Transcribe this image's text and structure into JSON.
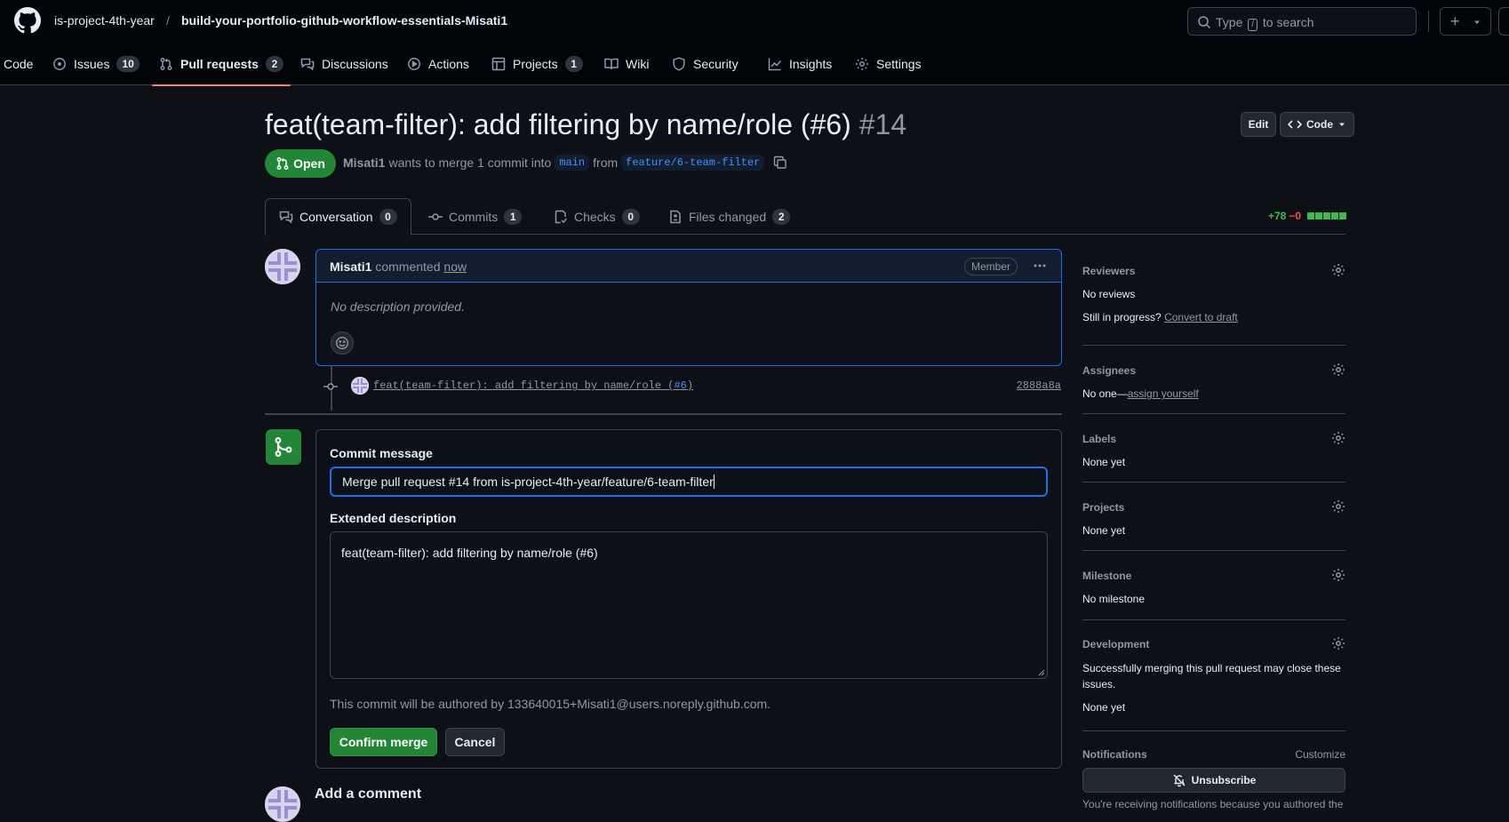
{
  "header": {
    "owner": "is-project-4th-year",
    "separator": "/",
    "repo": "build-your-portfolio-github-workflow-essentials-Misati1",
    "search": {
      "prefix": "Type",
      "key": "/",
      "suffix": "to search"
    }
  },
  "repo_nav": [
    {
      "label": "Code",
      "icon": "code-icon"
    },
    {
      "label": "Issues",
      "count": "10",
      "icon": "issue-icon"
    },
    {
      "label": "Pull requests",
      "count": "2",
      "icon": "pull-request-icon",
      "active": true
    },
    {
      "label": "Discussions",
      "icon": "discussion-icon"
    },
    {
      "label": "Actions",
      "icon": "play-icon"
    },
    {
      "label": "Projects",
      "count": "1",
      "icon": "table-icon"
    },
    {
      "label": "Wiki",
      "icon": "book-icon"
    },
    {
      "label": "Security",
      "icon": "shield-icon"
    },
    {
      "label": "Insights",
      "icon": "graph-icon"
    },
    {
      "label": "Settings",
      "icon": "gear-icon"
    }
  ],
  "pr": {
    "title": "feat(team-filter): add filtering by name/role (#6)",
    "number": "#14",
    "edit_label": "Edit",
    "code_label": "Code",
    "state": "Open",
    "author": "Misati1",
    "merge_text": "wants to merge 1 commit into",
    "base_branch": "main",
    "from_text": "from",
    "head_branch": "feature/6-team-filter"
  },
  "tabs": [
    {
      "label": "Conversation",
      "count": "0",
      "icon": "comment-discussion-icon",
      "active": true
    },
    {
      "label": "Commits",
      "count": "1",
      "icon": "commit-icon"
    },
    {
      "label": "Checks",
      "count": "0",
      "icon": "checklist-icon"
    },
    {
      "label": "Files changed",
      "count": "2",
      "icon": "file-diff-icon"
    }
  ],
  "diffstat": {
    "additions": "+78",
    "deletions": "−0"
  },
  "comment": {
    "author": "Misati1",
    "action": "commented",
    "time": "now",
    "role": "Member",
    "body": "No description provided."
  },
  "commit": {
    "message": "feat(team-filter): add filtering by name/role (",
    "link": "#6",
    "close": ")",
    "sha": "2888a8a"
  },
  "merge_form": {
    "commit_label": "Commit message",
    "commit_value": "Merge pull request #14 from is-project-4th-year/feature/6-team-filter",
    "ext_label": "Extended description",
    "ext_value": "feat(team-filter): add filtering by name/role (#6)",
    "authored_note": "This commit will be authored by 133640015+Misati1@users.noreply.github.com.",
    "confirm_label": "Confirm merge",
    "cancel_label": "Cancel"
  },
  "add_comment": "Add a comment",
  "sidebar": {
    "reviewers": {
      "heading": "Reviewers",
      "value": "No reviews",
      "progress_prefix": "Still in progress?",
      "progress_link": "Convert to draft"
    },
    "assignees": {
      "heading": "Assignees",
      "prefix": "No one—",
      "link": "assign yourself"
    },
    "labels": {
      "heading": "Labels",
      "value": "None yet"
    },
    "projects": {
      "heading": "Projects",
      "value": "None yet"
    },
    "milestone": {
      "heading": "Milestone",
      "value": "No milestone"
    },
    "development": {
      "heading": "Development",
      "note": "Successfully merging this pull request may close these issues.",
      "value": "None yet"
    },
    "notifications": {
      "heading": "Notifications",
      "customize": "Customize",
      "unsubscribe": "Unsubscribe",
      "note": "You're receiving notifications because you authored the"
    }
  },
  "colors": {
    "accent_green": "#238636",
    "accent_blue": "#1f6feb",
    "tab_underline": "#f78166",
    "background": "#0d1117"
  }
}
